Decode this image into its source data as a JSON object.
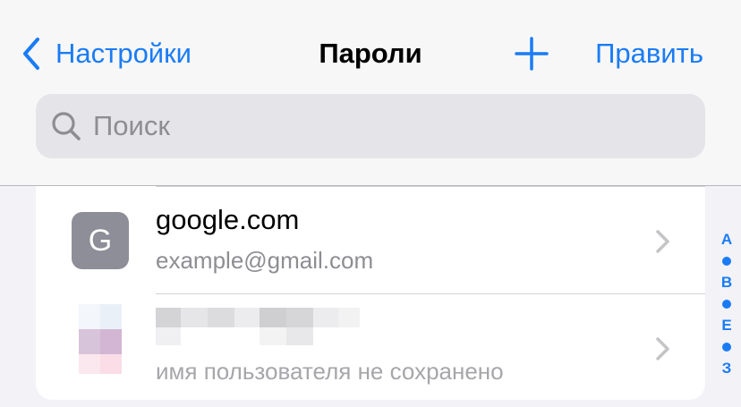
{
  "nav": {
    "back_label": "Настройки",
    "title": "Пароли",
    "edit_label": "Править"
  },
  "search": {
    "placeholder": "Поиск"
  },
  "passwords": [
    {
      "avatar_letter": "G",
      "site": "google.com",
      "username": "example@gmail.com"
    },
    {
      "site": "",
      "username": "имя пользователя не сохранено"
    }
  ],
  "section_index": {
    "a": "A",
    "b": "B",
    "e": "E",
    "z": "З"
  },
  "colors": {
    "accent": "#1a7cf5",
    "avatar_bg": "#8e8e98",
    "secondary_text": "#8d8d93"
  }
}
